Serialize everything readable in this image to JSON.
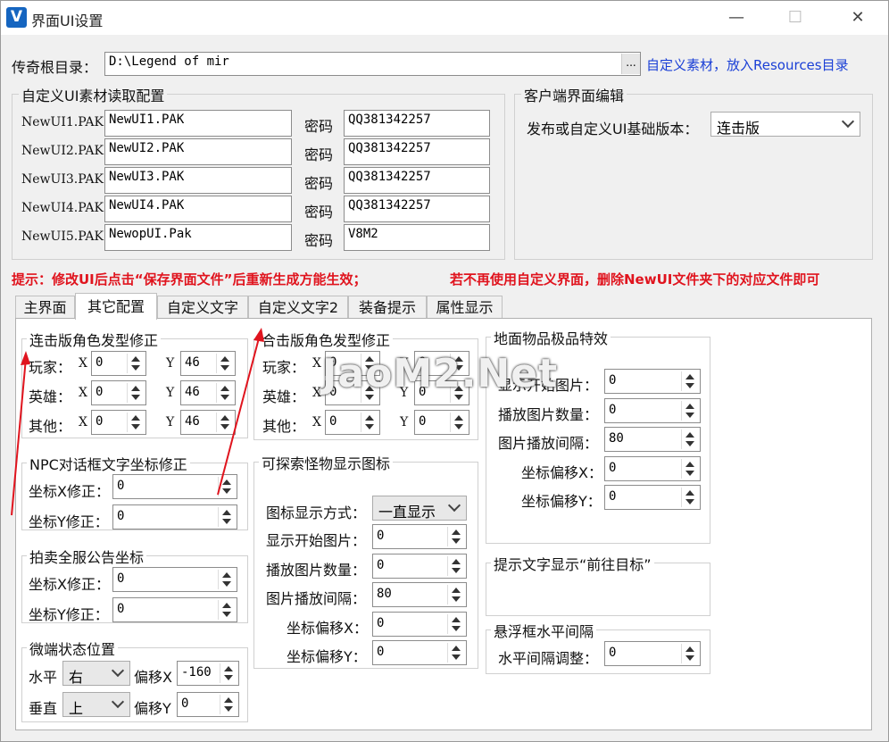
{
  "window": {
    "title": "界面UI设置",
    "logo_text": "V",
    "minimize_glyph": "—",
    "maximize_glyph": "☐",
    "close_glyph": "✕"
  },
  "root_dir": {
    "label": "传奇根目录：",
    "value": "D:\\Legend of mir",
    "browse_label": "...",
    "link": "自定义素材，放入Resources目录"
  },
  "ui_material": {
    "title": "自定义UI素材读取配置",
    "pwd_label": "密码",
    "rows": [
      {
        "label": "NewUI1.PAK",
        "file": "NewUI1.PAK",
        "password": "QQ381342257"
      },
      {
        "label": "NewUI2.PAK",
        "file": "NewUI2.PAK",
        "password": "QQ381342257"
      },
      {
        "label": "NewUI3.PAK",
        "file": "NewUI3.PAK",
        "password": "QQ381342257"
      },
      {
        "label": "NewUI4.PAK",
        "file": "NewUI4.PAK",
        "password": "QQ381342257"
      },
      {
        "label": "NewUI5.PAK",
        "file": "NewopUI.Pak",
        "password": "V8M2"
      }
    ]
  },
  "client_edit": {
    "title": "客户端界面编辑",
    "version_label": "发布或自定义UI基础版本：",
    "version_value": "连击版"
  },
  "notice": {
    "left": "提示：修改UI后点击“保存界面文件”后重新生成方能生效；",
    "right": "若不再使用自定义界面，删除NewUI文件夹下的对应文件即可"
  },
  "tabs": [
    {
      "label": "主界面"
    },
    {
      "label": "其它配置"
    },
    {
      "label": "自定义文字"
    },
    {
      "label": "自定义文字2"
    },
    {
      "label": "装备提示"
    },
    {
      "label": "属性显示"
    }
  ],
  "lianji_hair": {
    "title": "连击版角色发型修正",
    "rows": [
      {
        "label": "玩家：",
        "x": "0",
        "y": "46"
      },
      {
        "label": "英雄：",
        "x": "0",
        "y": "46"
      },
      {
        "label": "其他：",
        "x": "0",
        "y": "46"
      }
    ],
    "x_label": "X",
    "y_label": "Y"
  },
  "heji_hair": {
    "title": "合击版角色发型修正",
    "rows": [
      {
        "label": "玩家：",
        "x": "0",
        "y": "0"
      },
      {
        "label": "英雄：",
        "x": "0",
        "y": "0"
      },
      {
        "label": "其他：",
        "x": "0",
        "y": "0"
      }
    ],
    "x_label": "X",
    "y_label": "Y"
  },
  "npc_dialog": {
    "title": "NPC对话框文字坐标修正",
    "x_label": "坐标X修正：",
    "x_value": "0",
    "y_label": "坐标Y修正：",
    "y_value": "0"
  },
  "auction": {
    "title": "拍卖全服公告坐标",
    "x_label": "坐标X修正：",
    "x_value": "0",
    "y_label": "坐标Y修正：",
    "y_value": "0"
  },
  "micro": {
    "title": "微端状态位置",
    "h_label": "水平",
    "h_value": "右",
    "v_label": "垂直",
    "v_value": "上",
    "ox_label": "偏移X",
    "ox_value": "-160",
    "oy_label": "偏移Y",
    "oy_value": "0"
  },
  "monster_icon": {
    "title": "可探索怪物显示图标",
    "mode_label": "图标显示方式：",
    "mode_value": "一直显示",
    "start_label": "显示开始图片：",
    "start_value": "0",
    "count_label": "播放图片数量：",
    "count_value": "0",
    "interval_label": "图片播放间隔：",
    "interval_value": "80",
    "ox_label": "坐标偏移X：",
    "ox_value": "0",
    "oy_label": "坐标偏移Y：",
    "oy_value": "0"
  },
  "ground_item": {
    "title": "地面物品极品特效",
    "start_label": "显示开始图片：",
    "start_value": "0",
    "count_label": "播放图片数量：",
    "count_value": "0",
    "interval_label": "图片播放间隔：",
    "interval_value": "80",
    "ox_label": "坐标偏移X：",
    "ox_value": "0",
    "oy_label": "坐标偏移Y：",
    "oy_value": "0"
  },
  "hint_text": {
    "title": "提示文字显示“前往目标”"
  },
  "float_box": {
    "title": "悬浮框水平间隔",
    "label": "水平间隔调整：",
    "value": "0"
  },
  "watermark": "JaoM2.Net"
}
